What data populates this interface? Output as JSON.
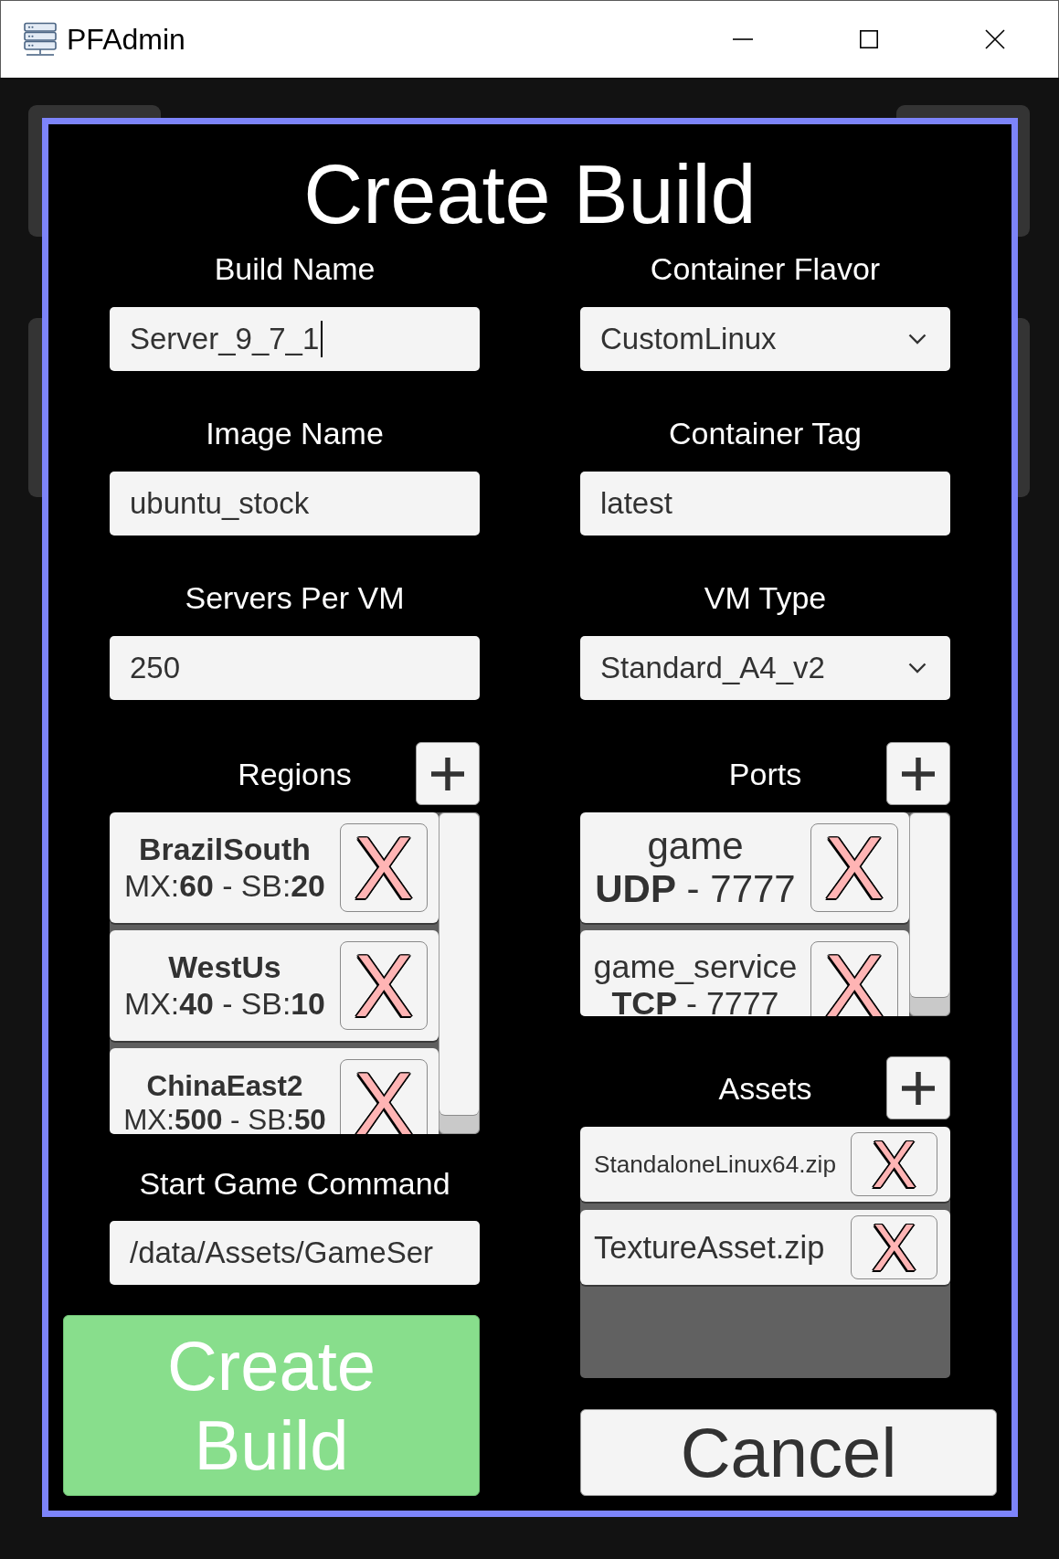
{
  "window": {
    "title": "PFAdmin"
  },
  "dialog": {
    "title": "Create Build"
  },
  "fields": [
    {
      "label": "Build Name",
      "kind": "text",
      "value": "Server_9_7_1",
      "focused": true
    },
    {
      "label": "Container Flavor",
      "kind": "dropdown",
      "value": "CustomLinux"
    },
    {
      "label": "Image Name",
      "kind": "text",
      "value": "ubuntu_stock",
      "focused": false
    },
    {
      "label": "Container Tag",
      "kind": "text",
      "value": "latest",
      "focused": false
    },
    {
      "label": "Servers Per VM",
      "kind": "text",
      "value": "250",
      "focused": false
    },
    {
      "label": "VM Type",
      "kind": "dropdown",
      "value": "Standard_A4_v2"
    }
  ],
  "regions": {
    "label": "Regions",
    "items": [
      {
        "name": "BrazilSouth",
        "limits": "MX:**60** - SB:**20**",
        "remove_button": "X"
      },
      {
        "name": "WestUs",
        "limits": "MX:**40** - SB:**10**",
        "remove_button": "X"
      },
      {
        "name": "ChinaEast2",
        "limits": "MX:**500** - SB:**50**",
        "remove_button": "X"
      }
    ]
  },
  "start_game_command": {
    "label": "Start Game Command",
    "value": "/data/Assets/GameSer"
  },
  "ports": {
    "label": "Ports",
    "items": [
      {
        "name": "game",
        "protocol_port": "**UDP** - 7777",
        "remove_button": "X"
      },
      {
        "name": "game_service",
        "protocol_port": "**TCP** - 7777",
        "remove_button": "X"
      }
    ]
  },
  "assets": {
    "label": "Assets",
    "items": [
      {
        "file": "StandaloneLinux64.zip",
        "remove_button": "X"
      },
      {
        "file": "TextureAsset.zip",
        "remove_button": "X"
      }
    ]
  },
  "buttons": [
    {
      "label": "Create Build",
      "kind": "primary"
    },
    {
      "label": "Cancel",
      "kind": "secondary"
    }
  ]
}
